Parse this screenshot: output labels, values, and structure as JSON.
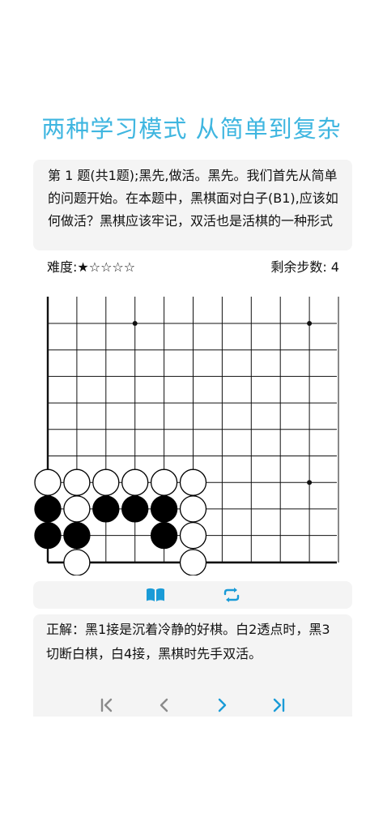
{
  "header": {
    "title": "两种学习模式 从简单到复杂"
  },
  "problem": {
    "text": "第 1 题(共1题);黑先,做活。黑先。我们首先从简单的问题开始。在本题中，黑棋面对白子(B1),应该如何做活？黑棋应该牢记，双活也是活棋的一种形式"
  },
  "meta": {
    "difficulty": "难度:★☆☆☆☆",
    "steps": "剩余步数: 4"
  },
  "board": {
    "stones": [
      {
        "c": 0,
        "r": 6,
        "color": "white"
      },
      {
        "c": 1,
        "r": 6,
        "color": "white"
      },
      {
        "c": 2,
        "r": 6,
        "color": "white"
      },
      {
        "c": 3,
        "r": 6,
        "color": "white"
      },
      {
        "c": 4,
        "r": 6,
        "color": "white"
      },
      {
        "c": 5,
        "r": 6,
        "color": "white"
      },
      {
        "c": 0,
        "r": 7,
        "color": "black"
      },
      {
        "c": 1,
        "r": 7,
        "color": "white"
      },
      {
        "c": 2,
        "r": 7,
        "color": "black"
      },
      {
        "c": 3,
        "r": 7,
        "color": "black"
      },
      {
        "c": 4,
        "r": 7,
        "color": "black"
      },
      {
        "c": 5,
        "r": 7,
        "color": "white"
      },
      {
        "c": 0,
        "r": 8,
        "color": "black"
      },
      {
        "c": 1,
        "r": 8,
        "color": "black"
      },
      {
        "c": 4,
        "r": 8,
        "color": "black"
      },
      {
        "c": 5,
        "r": 8,
        "color": "white"
      },
      {
        "c": 1,
        "r": 9,
        "color": "white"
      },
      {
        "c": 5,
        "r": 9,
        "color": "white"
      }
    ],
    "star_points": [
      {
        "c": 3,
        "r": 0
      },
      {
        "c": 9,
        "r": 0
      },
      {
        "c": 9,
        "r": 6
      }
    ]
  },
  "toolbar": {
    "book_icon": "book-open-icon",
    "swap_icon": "repeat-icon",
    "accent": "#1a9bd7"
  },
  "answer": {
    "text": "正解：黑1接是沉着冷静的好棋。白2透点时，黑3切断白棋，白4接，黑棋时先手双活。"
  },
  "nav": {
    "first_icon": "first-icon",
    "prev_icon": "prev-icon",
    "next_icon": "next-icon",
    "last_icon": "last-icon"
  }
}
